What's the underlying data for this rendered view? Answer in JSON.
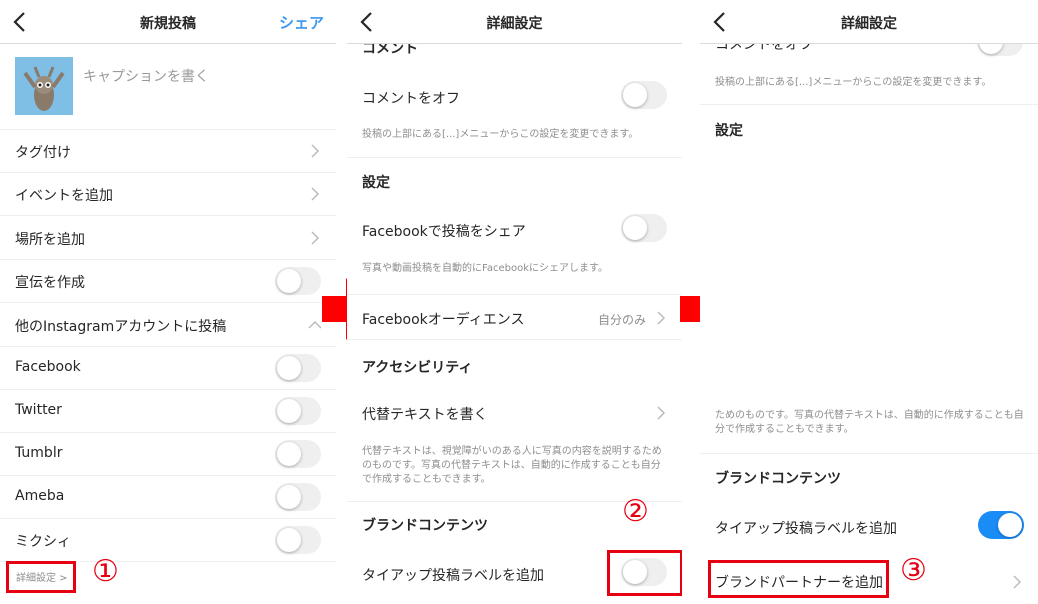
{
  "colors": {
    "accent": "#3897f0",
    "toggle_on": "#1a8cf5",
    "annotation": "#e60012"
  },
  "panel1": {
    "title": "新規投稿",
    "share": "シェア",
    "caption_placeholder": "キャプションを書く",
    "rows": {
      "tag": "タグ付け",
      "event": "イベントを追加",
      "place": "場所を追加",
      "promo": "宣伝を作成",
      "other": "他のInstagramアカウントに投稿",
      "facebook": "Facebook",
      "twitter": "Twitter",
      "tumblr": "Tumblr",
      "ameba": "Ameba",
      "mixi": "ミクシィ"
    },
    "advanced": "詳細設定 >",
    "step": "①"
  },
  "panel2": {
    "title": "詳細設定",
    "comment_section": "コメント",
    "comment_off": "コメントをオフ",
    "comment_note": "投稿の上部にある[...]メニューからこの設定を変更できます。",
    "settings": "設定",
    "fb_share": "Facebookで投稿をシェア",
    "fb_note": "写真や動画投稿を自動的にFacebookにシェアします。",
    "fb_audience": "Facebookオーディエンス",
    "fb_audience_value": "自分のみ",
    "accessibility": "アクセシビリティ",
    "alt_text": "代替テキストを書く",
    "alt_note": "代替テキストは、視覚障がいのある人に写真の内容を説明するためのものです。写真の代替テキストは、自動的に作成することも自分で作成することもできます。",
    "brand": "ブランドコンテンツ",
    "tieup": "タイアップ投稿ラベルを追加",
    "step": "②"
  },
  "panel3": {
    "title": "詳細設定",
    "comment_off_partial": "コメントをオフ",
    "comment_note": "投稿の上部にある[...]メニューからこの設定を変更できます。",
    "settings": "設定",
    "alt_note_partial": "ためのものです。写真の代替テキストは、自動的に作成することも自分で作成することもできます。",
    "brand": "ブランドコンテンツ",
    "tieup": "タイアップ投稿ラベルを追加",
    "partner": "ブランドパートナーを追加",
    "step": "③"
  }
}
